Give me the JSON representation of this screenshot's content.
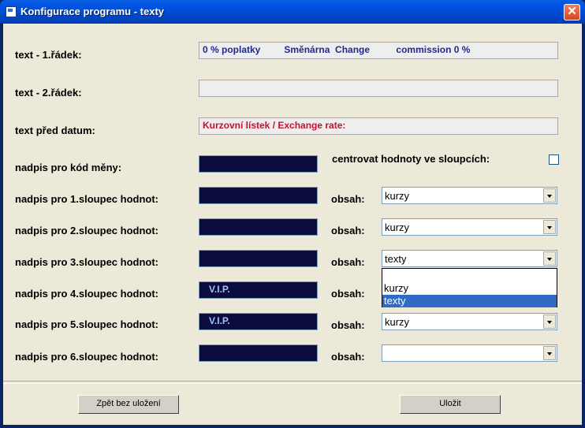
{
  "window": {
    "title": "Konfigurace programu - texty",
    "close_glyph": "✕"
  },
  "labels": {
    "text1": "text - 1.řádek:",
    "text2": "text - 2.řádek:",
    "before_date": "text před datum:",
    "currency_code": "nadpis pro kód měny:",
    "col1": "nadpis pro 1.sloupec hodnot:",
    "col2": "nadpis pro 2.sloupec hodnot:",
    "col3": "nadpis pro 3.sloupec hodnot:",
    "col4": "nadpis pro 4.sloupec hodnot:",
    "col5": "nadpis pro 5.sloupec hodnot:",
    "col6": "nadpis pro 6.sloupec hodnot:",
    "center_values": "centrovat hodnoty ve sloupcích:",
    "content": "obsah:"
  },
  "fields": {
    "text1": "0 % poplatky         Směnárna  Change          commission 0 %",
    "text2": "",
    "before_date": "Kurzovní lístek / Exchange rate:",
    "currency_code": "",
    "col1": "",
    "col2": "",
    "col3": "",
    "col4": "V.I.P.",
    "col5": "V.I.P.",
    "col6": ""
  },
  "colors": {
    "text1": "#1E2A8C",
    "before_date": "#C8102E"
  },
  "selects": {
    "col1": "kurzy",
    "col2": "kurzy",
    "col3": "texty",
    "col5": "kurzy",
    "col6": ""
  },
  "dropdown_open": {
    "options": [
      "",
      "kurzy",
      "texty"
    ],
    "selected": "texty"
  },
  "checkbox": {
    "center_values": false
  },
  "buttons": {
    "back": "Zpět bez uložení",
    "save": "Uložit"
  }
}
